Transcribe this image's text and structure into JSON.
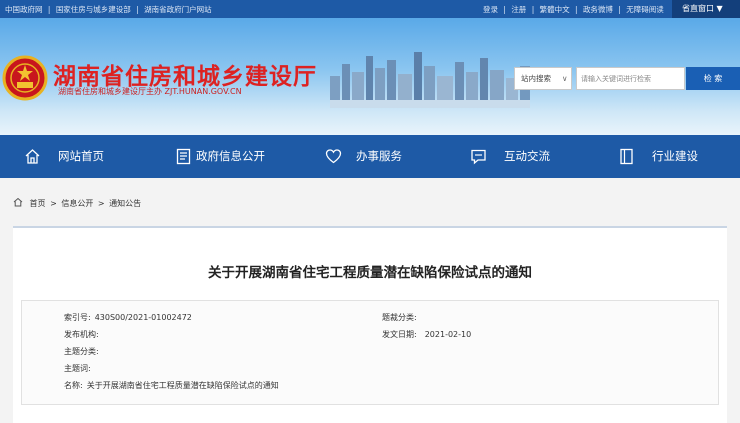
{
  "topbar": {
    "links_left": [
      "中国政府网",
      "|",
      "国家住房与城乡建设部",
      "|",
      "湖南省政府门户网站"
    ],
    "links_right": [
      "登录",
      "|",
      "注册",
      "|",
      "繁體中文",
      "|",
      "政务微博",
      "|",
      "无障碍阅读"
    ],
    "portal_label": "省直窗口 ▼"
  },
  "banner": {
    "title": "湖南省住房和城乡建设厅",
    "subtitle": "湖南省住房和城乡建设厅主办  ZJT.HUNAN.GOV.CN"
  },
  "search": {
    "scope_label": "站内搜索",
    "scope_arrow": "∨",
    "placeholder": "请输入关键词进行检索",
    "button_label": "检 索"
  },
  "nav": {
    "items": [
      {
        "label": "网站首页",
        "icon": "home-icon"
      },
      {
        "label": "政府信息公开",
        "icon": "document-icon"
      },
      {
        "label": "办事服务",
        "icon": "heart-icon"
      },
      {
        "label": "互动交流",
        "icon": "chat-icon"
      },
      {
        "label": "行业建设",
        "icon": "building-icon"
      }
    ]
  },
  "breadcrumb": {
    "items": [
      "首页",
      ">",
      "信息公开",
      ">",
      "通知公告"
    ]
  },
  "article": {
    "title": "关于开展湖南省住宅工程质量潜在缺陷保险试点的通知",
    "meta": {
      "index_label": "索引号:",
      "index_value": "430S00/2021-01002472",
      "category_label": "题裁分类:",
      "category_value": "",
      "publisher_label": "发布机构:",
      "publisher_value": "",
      "date_label": "发文日期:",
      "date_value": "2021-02-10",
      "topic_label": "主题分类:",
      "topic_value": "",
      "keywords_label": "主题词:",
      "keywords_value": "",
      "name_label": "名称:",
      "name_value": "关于开展湖南省住宅工程质量潜在缺陷保险试点的通知"
    }
  },
  "colors": {
    "primary_blue": "#1e5aa6",
    "title_red": "#dd2222"
  }
}
